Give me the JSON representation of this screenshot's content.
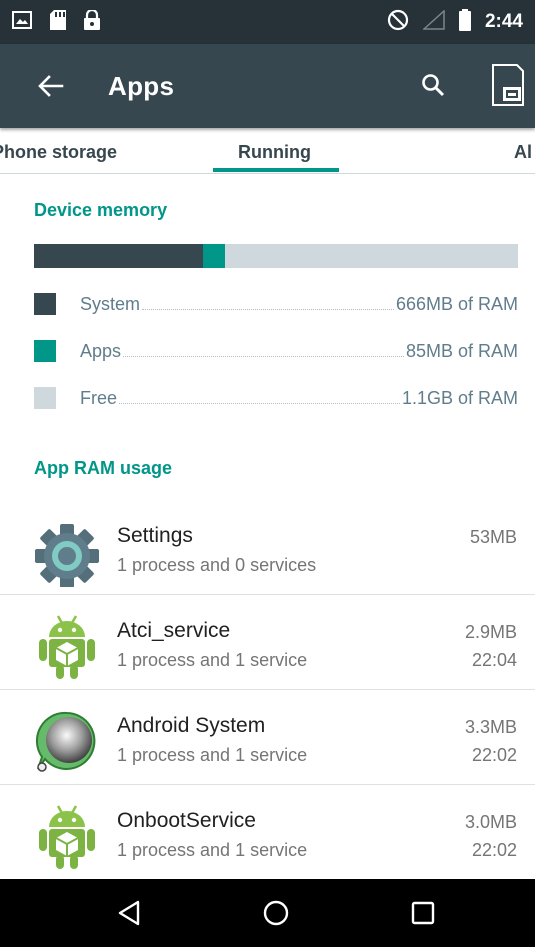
{
  "status_bar": {
    "time": "2:44",
    "icons": [
      "image-icon",
      "sd-card-icon",
      "lock-icon",
      "do-not-disturb-icon",
      "signal-icon",
      "battery-icon"
    ]
  },
  "toolbar": {
    "title": "Apps",
    "back_icon": "arrow-back-icon",
    "search_icon": "search-icon",
    "storage_icon": "storage-icon"
  },
  "tabs": [
    {
      "label": "Phone storage",
      "selected": false
    },
    {
      "label": "Running",
      "selected": true
    },
    {
      "label": "Al",
      "selected": false
    }
  ],
  "device_memory": {
    "heading": "Device memory",
    "bar": {
      "system_fraction": 0.35,
      "apps_fraction": 0.045
    },
    "legend": [
      {
        "label": "System",
        "value": "666MB of RAM",
        "color": "#37474f"
      },
      {
        "label": "Apps",
        "value": "85MB of RAM",
        "color": "#009688"
      },
      {
        "label": "Free",
        "value": "1.1GB of RAM",
        "color": "#cfd8dc"
      }
    ]
  },
  "app_ram": {
    "heading": "App RAM usage",
    "apps": [
      {
        "name": "Settings",
        "subtitle": "1 process and 0 services",
        "size": "53MB",
        "time": "",
        "icon": "settings-gear-icon"
      },
      {
        "name": "Atci_service",
        "subtitle": "1 process and 1 service",
        "size": "2.9MB",
        "time": "22:04",
        "icon": "android-robot-icon"
      },
      {
        "name": "Android System",
        "subtitle": "1 process and 1 service",
        "size": "3.3MB",
        "time": "22:02",
        "icon": "android-system-icon"
      },
      {
        "name": "OnbootService",
        "subtitle": "1 process and 1 service",
        "size": "3.0MB",
        "time": "22:02",
        "icon": "android-robot-icon"
      }
    ]
  },
  "nav_bar": {
    "icons": [
      "back-triangle-icon",
      "home-circle-icon",
      "recents-square-icon"
    ]
  },
  "colors": {
    "accent": "#009688",
    "toolbar": "#37474f",
    "status_bar": "#263238"
  }
}
